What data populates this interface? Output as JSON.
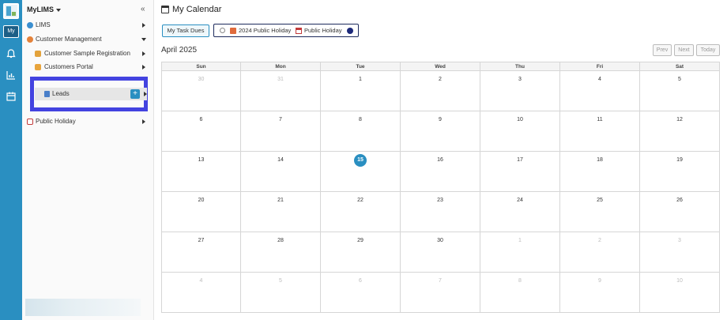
{
  "sidebar": {
    "title": "MyLIMS",
    "collapse_glyph": "«",
    "items": [
      {
        "label": "LIMS",
        "icon": "globe-icon",
        "expanded": false
      },
      {
        "label": "Customer Management",
        "icon": "customer-icon",
        "expanded": true
      },
      {
        "label": "Customer Sample Registration",
        "icon": "form-icon",
        "expanded": false
      },
      {
        "label": "Customers Portal",
        "icon": "portal-icon",
        "expanded": false
      },
      {
        "label": "Public Holiday",
        "icon": "calendar-icon",
        "expanded": false
      }
    ],
    "leads": {
      "label": "Leads",
      "add_glyph": "+"
    }
  },
  "rail": {
    "my_label": "My"
  },
  "header": {
    "title": "My Calendar"
  },
  "toolbar": {
    "task_button": "My Task Dues",
    "legend": [
      {
        "label": "2024 Public Holiday"
      },
      {
        "label": "Public Holiday"
      }
    ],
    "legend_dot_color": "#1d2a7a"
  },
  "calendar": {
    "month_label": "April 2025",
    "nav": {
      "prev": "Prev",
      "next": "Next",
      "today": "Today"
    },
    "weekdays": [
      "Sun",
      "Mon",
      "Tue",
      "Wed",
      "Thu",
      "Fri",
      "Sat"
    ],
    "weeks": [
      [
        "30",
        "31",
        "1",
        "2",
        "3",
        "4",
        "5"
      ],
      [
        "6",
        "7",
        "8",
        "9",
        "10",
        "11",
        "12"
      ],
      [
        "13",
        "14",
        "15",
        "16",
        "17",
        "18",
        "19"
      ],
      [
        "20",
        "21",
        "22",
        "23",
        "24",
        "25",
        "26"
      ],
      [
        "27",
        "28",
        "29",
        "30",
        "1",
        "2",
        "3"
      ],
      [
        "4",
        "5",
        "6",
        "7",
        "8",
        "9",
        "10"
      ]
    ],
    "today": "15",
    "accent_color": "#2a8fc1"
  }
}
